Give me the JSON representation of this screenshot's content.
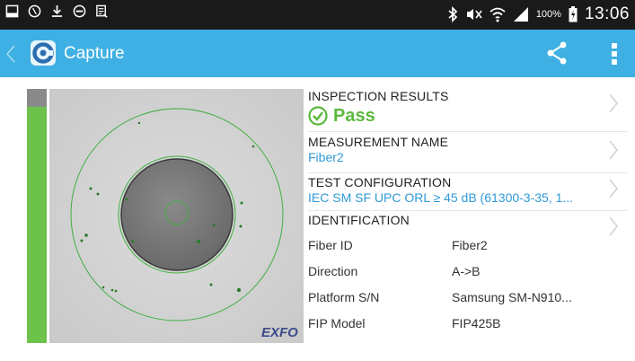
{
  "status_bar": {
    "battery_percent": "100%",
    "time": "13:06",
    "icons": [
      "screenshot-icon",
      "alarm-icon",
      "download-icon",
      "do-not-disturb-icon",
      "document-icon",
      "bluetooth-icon",
      "mute-icon",
      "wifi-icon",
      "signal-icon",
      "battery-icon"
    ]
  },
  "action_bar": {
    "title": "Capture",
    "icons": [
      "back-chevron-icon",
      "app-logo-icon",
      "share-icon",
      "overflow-menu-icon"
    ]
  },
  "image_panel": {
    "watermark": "EXFO"
  },
  "results": {
    "inspection": {
      "label": "INSPECTION RESULTS",
      "status": "Pass"
    },
    "measurement": {
      "label": "MEASUREMENT NAME",
      "value": "Fiber2"
    },
    "test_config": {
      "label": "TEST CONFIGURATION",
      "value": "IEC SM SF UPC ORL ≥ 45 dB (61300-3-35, 1..."
    },
    "identification": {
      "label": "IDENTIFICATION",
      "rows": [
        {
          "key": "Fiber ID",
          "value": "Fiber2"
        },
        {
          "key": "Direction",
          "value": "A->B"
        },
        {
          "key": "Platform S/N",
          "value": "Samsung SM-N910..."
        },
        {
          "key": "FIP Model",
          "value": "FIP425B"
        }
      ]
    }
  },
  "colors": {
    "action_bar": "#3fb0e3",
    "status_bar": "#1a1a1a",
    "pass_green": "#5cb83c",
    "link_blue": "#2f9ad6"
  }
}
